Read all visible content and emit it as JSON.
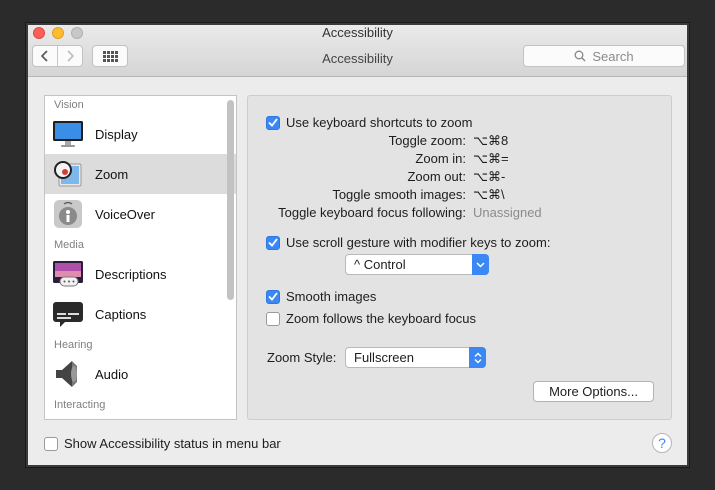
{
  "window": {
    "title": "Accessibility",
    "toolbar_title": "Accessibility",
    "search_placeholder": "Search"
  },
  "sidebar": {
    "sections": [
      {
        "label": "Vision",
        "items": [
          {
            "label": "Display",
            "icon": "display-icon"
          },
          {
            "label": "Zoom",
            "icon": "zoom-icon",
            "selected": true
          },
          {
            "label": "VoiceOver",
            "icon": "voiceover-icon"
          }
        ]
      },
      {
        "label": "Media",
        "items": [
          {
            "label": "Descriptions",
            "icon": "descriptions-icon"
          },
          {
            "label": "Captions",
            "icon": "captions-icon"
          }
        ]
      },
      {
        "label": "Hearing",
        "items": [
          {
            "label": "Audio",
            "icon": "audio-icon"
          }
        ]
      },
      {
        "label": "Interacting",
        "items": []
      }
    ]
  },
  "zoom": {
    "keyboard_shortcuts": {
      "label": "Use keyboard shortcuts to zoom",
      "checked": true
    },
    "shortcuts": [
      {
        "label": "Toggle zoom:",
        "value": "⌥⌘8"
      },
      {
        "label": "Zoom in:",
        "value": "⌥⌘="
      },
      {
        "label": "Zoom out:",
        "value": "⌥⌘-"
      },
      {
        "label": "Toggle smooth images:",
        "value": "⌥⌘\\"
      },
      {
        "label": "Toggle keyboard focus following:",
        "value": "Unassigned"
      }
    ],
    "scroll_gesture": {
      "label": "Use scroll gesture with modifier keys to zoom:",
      "checked": true
    },
    "modifier_value": "^ Control",
    "smooth_images": {
      "label": "Smooth images",
      "checked": true
    },
    "follow_focus": {
      "label": "Zoom follows the keyboard focus",
      "checked": false
    },
    "zoom_style_label": "Zoom Style:",
    "zoom_style_value": "Fullscreen",
    "more_options": "More Options..."
  },
  "footer": {
    "status_label": "Show Accessibility status in menu bar",
    "status_checked": false,
    "help": "?"
  },
  "colors": {
    "accent": "#3b88f5",
    "selected_row": "#dcdcdc"
  }
}
